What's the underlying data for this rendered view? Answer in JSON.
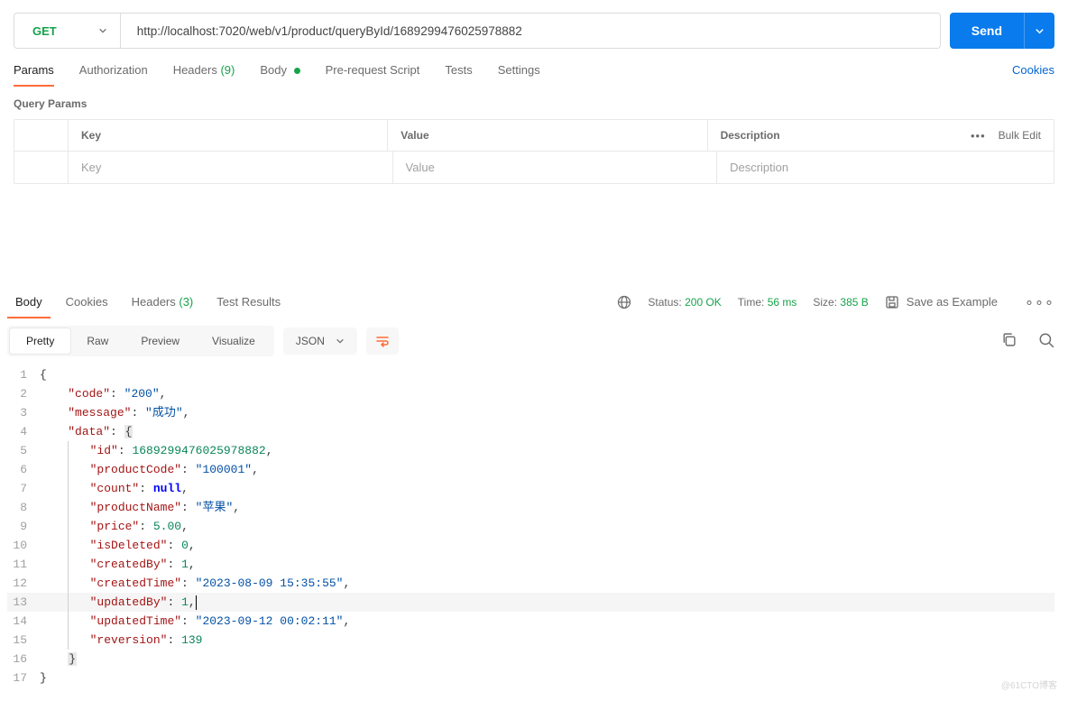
{
  "request": {
    "method": "GET",
    "url": "http://localhost:7020/web/v1/product/queryById/1689299476025978882",
    "sendLabel": "Send"
  },
  "reqTabs": {
    "params": "Params",
    "auth": "Authorization",
    "headers": "Headers",
    "headersCount": "(9)",
    "body": "Body",
    "preReq": "Pre-request Script",
    "tests": "Tests",
    "settings": "Settings",
    "cookies": "Cookies"
  },
  "querySection": {
    "title": "Query Params",
    "keyHeader": "Key",
    "valueHeader": "Value",
    "descHeader": "Description",
    "bulkEdit": "Bulk Edit",
    "keyPlaceholder": "Key",
    "valuePlaceholder": "Value",
    "descPlaceholder": "Description"
  },
  "respTabs": {
    "body": "Body",
    "cookies": "Cookies",
    "headers": "Headers",
    "headersCount": "(3)",
    "testResults": "Test Results"
  },
  "status": {
    "statusLabel": "Status:",
    "statusValue": "200 OK",
    "timeLabel": "Time:",
    "timeValue": "56 ms",
    "sizeLabel": "Size:",
    "sizeValue": "385 B",
    "saveExample": "Save as Example"
  },
  "viewModes": {
    "pretty": "Pretty",
    "raw": "Raw",
    "preview": "Preview",
    "visualize": "Visualize",
    "json": "JSON"
  },
  "json": {
    "code": {
      "k": "\"code\"",
      "v": "\"200\""
    },
    "message": {
      "k": "\"message\"",
      "v": "\"成功\""
    },
    "data": {
      "k": "\"data\""
    },
    "id": {
      "k": "\"id\"",
      "v": "1689299476025978882"
    },
    "productCode": {
      "k": "\"productCode\"",
      "v": "\"100001\""
    },
    "count": {
      "k": "\"count\"",
      "v": "null"
    },
    "productName": {
      "k": "\"productName\"",
      "v": "\"苹果\""
    },
    "price": {
      "k": "\"price\"",
      "v": "5.00"
    },
    "isDeleted": {
      "k": "\"isDeleted\"",
      "v": "0"
    },
    "createdBy": {
      "k": "\"createdBy\"",
      "v": "1"
    },
    "createdTime": {
      "k": "\"createdTime\"",
      "v": "\"2023-08-09 15:35:55\""
    },
    "updatedBy": {
      "k": "\"updatedBy\"",
      "v": "1"
    },
    "updatedTime": {
      "k": "\"updatedTime\"",
      "v": "\"2023-09-12 00:02:11\""
    },
    "reversion": {
      "k": "\"reversion\"",
      "v": "139"
    }
  },
  "lineNumbers": [
    "1",
    "2",
    "3",
    "4",
    "5",
    "6",
    "7",
    "8",
    "9",
    "10",
    "11",
    "12",
    "13",
    "14",
    "15",
    "16",
    "17"
  ],
  "watermark": "@61CTO博客"
}
